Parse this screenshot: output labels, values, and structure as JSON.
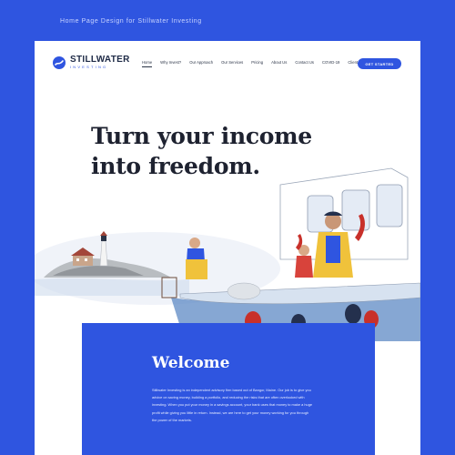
{
  "caption": "Home Page Design for Stillwater Investing",
  "brand": {
    "name": "STILLWATER",
    "tagline": "INVESTING",
    "color": "#2f55e0"
  },
  "nav": {
    "items": [
      {
        "label": "Home",
        "active": true
      },
      {
        "label": "Why Invest?"
      },
      {
        "label": "Our Approach"
      },
      {
        "label": "Our Services"
      },
      {
        "label": "Pricing"
      },
      {
        "label": "About Us"
      },
      {
        "label": "Contact Us"
      },
      {
        "label": "COVID-19"
      },
      {
        "label": "Client Resources"
      }
    ],
    "cta_label": "GET STARTED"
  },
  "hero": {
    "headline_line1": "Turn your income",
    "headline_line2": "into freedom.",
    "illustration": "watercolor lighthouse and fishing boat with fishermen holding lobster"
  },
  "welcome": {
    "title": "Welcome",
    "body": "Stillwater Investing is an independent advisory firm based out of Bangor, Maine. Our job is to give you advice on saving money, building a portfolio, and reducing the risks that are often overlooked with investing. When you put your money in a savings account, your bank uses that money to make a huge profit while giving you little in return. Instead, we are here to get your money working for you through the power of the markets."
  },
  "colors": {
    "background": "#2f55e0",
    "card": "#ffffff",
    "text_dark": "#1e2230"
  }
}
